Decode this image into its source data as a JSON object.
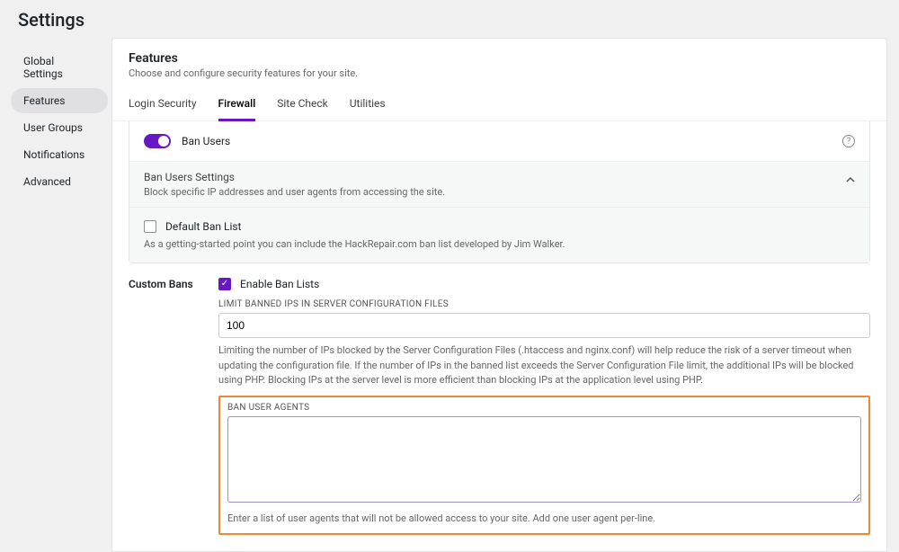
{
  "page": {
    "title": "Settings"
  },
  "sidebar": {
    "items": [
      {
        "label": "Global Settings"
      },
      {
        "label": "Features"
      },
      {
        "label": "User Groups"
      },
      {
        "label": "Notifications"
      },
      {
        "label": "Advanced"
      }
    ]
  },
  "header": {
    "title": "Features",
    "subtitle": "Choose and configure security features for your site."
  },
  "tabs": [
    {
      "label": "Login Security"
    },
    {
      "label": "Firewall"
    },
    {
      "label": "Site Check"
    },
    {
      "label": "Utilities"
    }
  ],
  "banUsers": {
    "toggleLabel": "Ban Users",
    "settingsTitle": "Ban Users Settings",
    "settingsDesc": "Block specific IP addresses and user agents from accessing the site.",
    "defaultListLabel": "Default Ban List",
    "defaultListHint": "As a getting-started point you can include the HackRepair.com ban list developed by Jim Walker."
  },
  "customBans": {
    "sectionTitle": "Custom Bans",
    "enableLabel": "Enable Ban Lists",
    "limitLabel": "LIMIT BANNED IPS IN SERVER CONFIGURATION FILES",
    "limitValue": "100",
    "limitHelp": "Limiting the number of IPs blocked by the Server Configuration Files (.htaccess and nginx.conf) will help reduce the risk of a server timeout when updating the configuration file. If the number of IPs in the banned list exceeds the Server Configuration File limit, the additional IPs will be blocked using PHP. Blocking IPs at the server level is more efficient than blocking IPs at the application level using PHP.",
    "uaLabel": "BAN USER AGENTS",
    "uaValue": "",
    "uaHelp": "Enter a list of user agents that will not be allowed access to your site. Add one user agent per-line."
  },
  "icons": {
    "help": "?"
  }
}
